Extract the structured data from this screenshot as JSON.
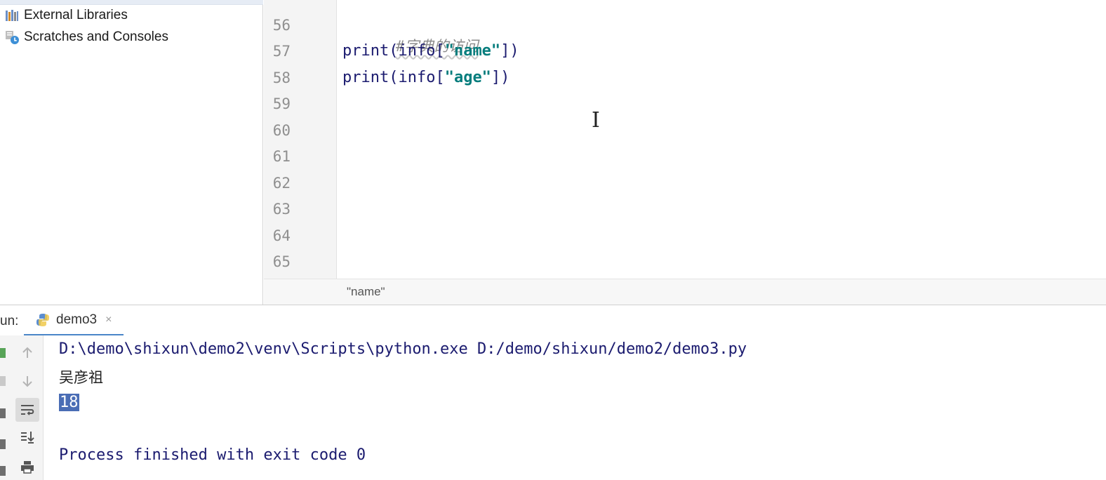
{
  "sidebar": {
    "items": [
      {
        "label": "External Libraries",
        "icon": "library-icon"
      },
      {
        "label": "Scratches and Consoles",
        "icon": "scratches-icon"
      }
    ]
  },
  "editor": {
    "line_numbers": [
      "56",
      "57",
      "58",
      "59",
      "60",
      "61",
      "62",
      "63",
      "64",
      "65"
    ],
    "lines": {
      "comment": "#字典的访问",
      "l57_fn": "print(info[",
      "l57_str": "\"name\"",
      "l57_end": "])",
      "l58_fn": "print(info[",
      "l58_str": "\"age\"",
      "l58_end": "])"
    },
    "cursor_glyph": "I"
  },
  "breadcrumb": {
    "text": "\"name\""
  },
  "run": {
    "label": "un:",
    "tab_label": "demo3",
    "tab_close": "×",
    "console": {
      "command": "D:\\demo\\shixun\\demo2\\venv\\Scripts\\python.exe D:/demo/shixun/demo2/demo3.py",
      "output_1": "吴彦祖",
      "output_2": "18",
      "finish": "Process finished with exit code 0"
    }
  },
  "colors": {
    "keyword_blue": "#1b1b6f",
    "string_teal": "#067d7d",
    "comment_gray": "#8c8c8c",
    "selection": "#4a6db5",
    "tab_accent": "#4a86c8"
  }
}
